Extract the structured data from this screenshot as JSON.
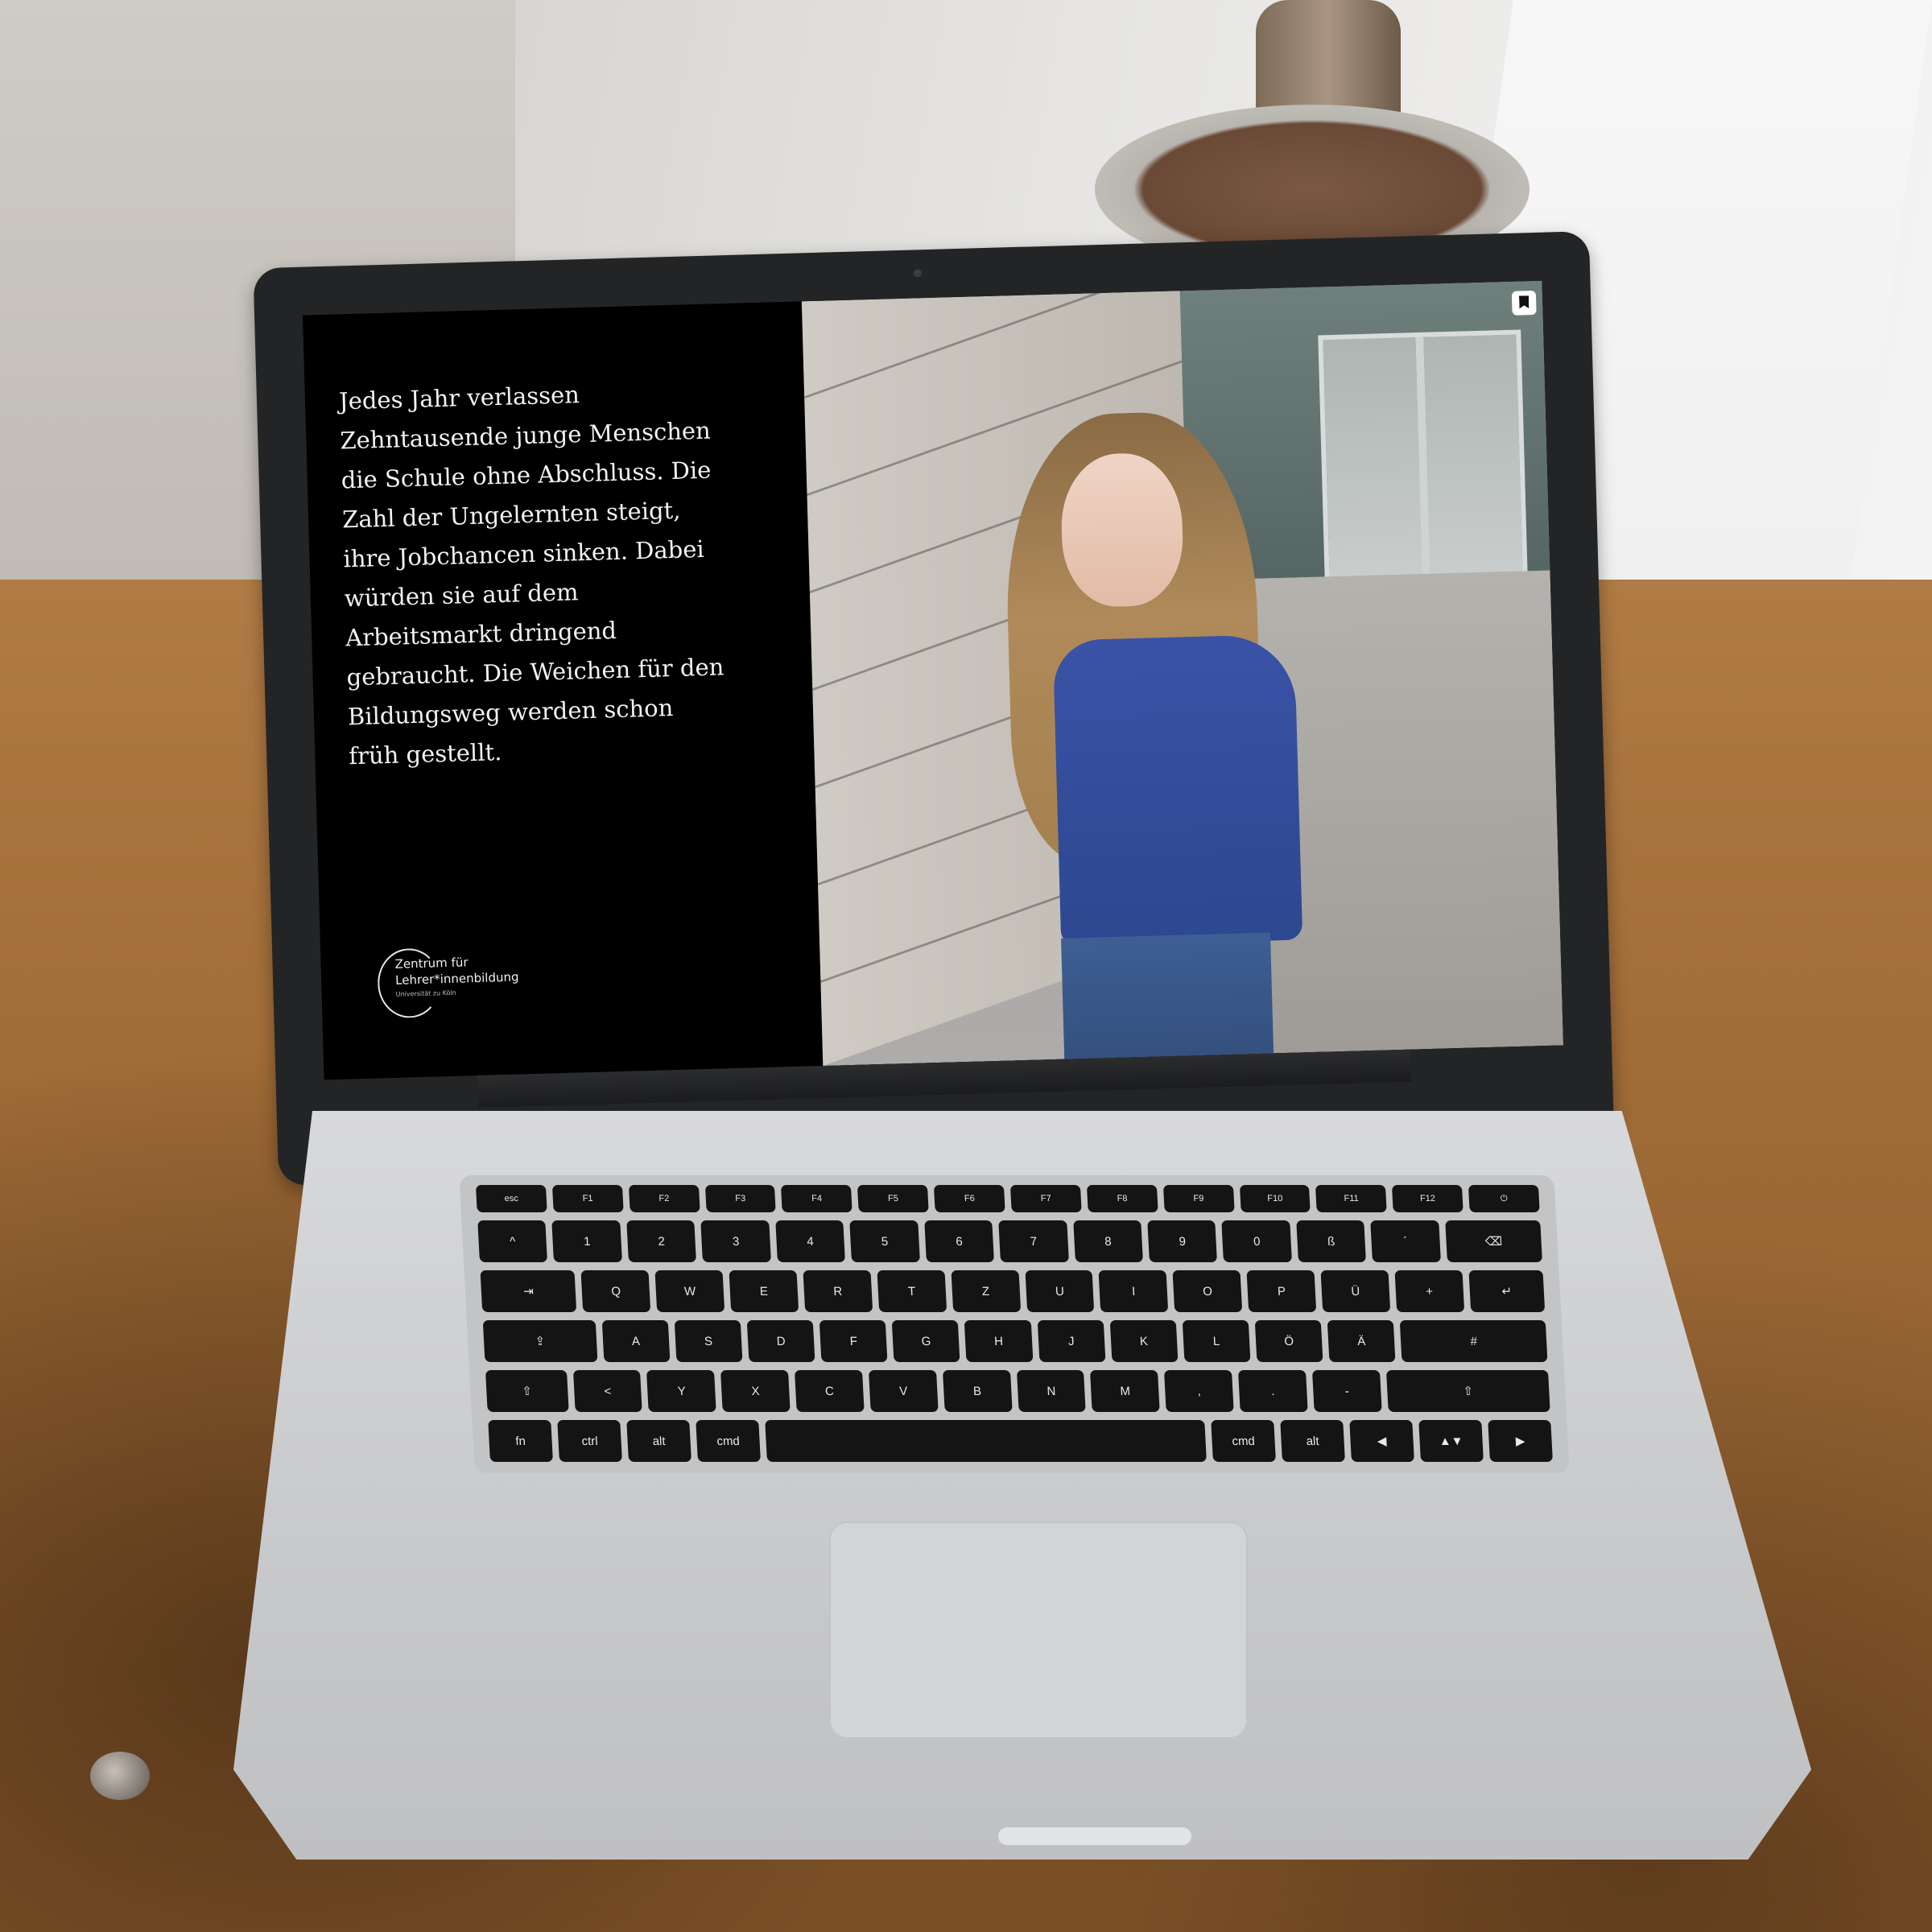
{
  "screen": {
    "body_text": "Jedes Jahr verlassen Zehntausende junge Menschen die Schule ohne Abschluss. Die Zahl der Ungelernten steigt, ihre Jobchancen sinken. Dabei würden sie auf dem Arbeitsmarkt dringend gebraucht. Die Weichen für den Bildungsweg werden schon früh gestellt.",
    "logo": {
      "line1": "Zentrum für",
      "line2": "Lehrer*innenbildung",
      "line3": "Universität zu Köln"
    },
    "corner_icon": "bookmark-icon",
    "colors": {
      "text_pane_bg": "#000000",
      "text_color": "#f2f2f2",
      "shirt": "#3a53a6"
    }
  },
  "keyboard": {
    "rows": [
      [
        "esc",
        "F1",
        "F2",
        "F3",
        "F4",
        "F5",
        "F6",
        "F7",
        "F8",
        "F9",
        "F10",
        "F11",
        "F12",
        "⏻"
      ],
      [
        "^",
        "1",
        "2",
        "3",
        "4",
        "5",
        "6",
        "7",
        "8",
        "9",
        "0",
        "ß",
        "´",
        "⌫"
      ],
      [
        "⇥",
        "Q",
        "W",
        "E",
        "R",
        "T",
        "Z",
        "U",
        "I",
        "O",
        "P",
        "Ü",
        "+",
        "↵"
      ],
      [
        "⇪",
        "A",
        "S",
        "D",
        "F",
        "G",
        "H",
        "J",
        "K",
        "L",
        "Ö",
        "Ä",
        "#"
      ],
      [
        "⇧",
        "<",
        "Y",
        "X",
        "C",
        "V",
        "B",
        "N",
        "M",
        ",",
        ".",
        "-",
        "⇧"
      ],
      [
        "fn",
        "ctrl",
        "alt",
        "cmd",
        "",
        "cmd",
        "alt",
        "◀",
        "▲▼",
        "▶"
      ]
    ]
  }
}
